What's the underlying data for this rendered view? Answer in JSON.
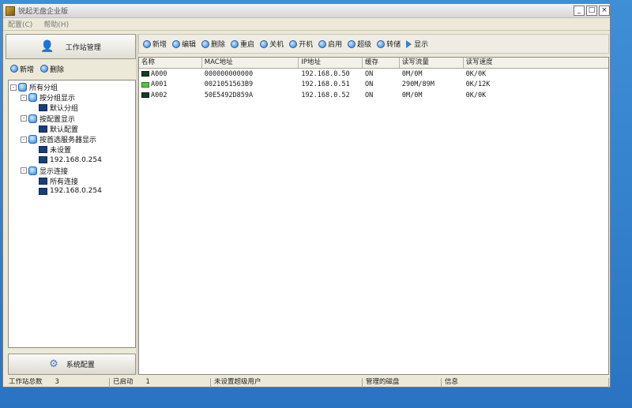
{
  "window": {
    "title": "锐起无盘企业版",
    "controls": {
      "minimize": "_",
      "maximize": "□",
      "close": "×"
    }
  },
  "menu": [
    {
      "label": "配置(C)"
    },
    {
      "label": "帮助(H)"
    }
  ],
  "left_panel": {
    "workstation_button": "工作站管理",
    "add_label": "新增",
    "delete_label": "删除",
    "tree": [
      {
        "label": "所有分组",
        "level": 0,
        "expander": "-",
        "icon": "blue"
      },
      {
        "label": "按分组显示",
        "level": 1,
        "expander": "-",
        "icon": "blue"
      },
      {
        "label": "默认分组",
        "level": 2,
        "expander": "",
        "icon": "host"
      },
      {
        "label": "按配置显示",
        "level": 1,
        "expander": "-",
        "icon": "blue"
      },
      {
        "label": "默认配置",
        "level": 2,
        "expander": "",
        "icon": "host"
      },
      {
        "label": "按首选服务器显示",
        "level": 1,
        "expander": "-",
        "icon": "blue"
      },
      {
        "label": "未设置",
        "level": 2,
        "expander": "",
        "icon": "host"
      },
      {
        "label": "192.168.0.254",
        "level": 2,
        "expander": "",
        "icon": "host"
      },
      {
        "label": "显示连接",
        "level": 1,
        "expander": "-",
        "icon": "blue"
      },
      {
        "label": "所有连接",
        "level": 2,
        "expander": "",
        "icon": "host"
      },
      {
        "label": "192.168.0.254",
        "level": 2,
        "expander": "",
        "icon": "host"
      }
    ],
    "system_button": "系统配置"
  },
  "toolbar": [
    {
      "label": "新增",
      "icon": "add-icon"
    },
    {
      "label": "编辑",
      "icon": "edit-icon"
    },
    {
      "label": "删除",
      "icon": "delete-icon"
    },
    {
      "label": "重启",
      "icon": "restart-icon"
    },
    {
      "label": "关机",
      "icon": "shutdown-icon"
    },
    {
      "label": "开机",
      "icon": "power-on-icon"
    },
    {
      "label": "启用",
      "icon": "enable-icon"
    },
    {
      "label": "超级",
      "icon": "super-icon"
    },
    {
      "label": "转储",
      "icon": "dump-icon"
    },
    {
      "label": "显示",
      "icon": "play-icon"
    }
  ],
  "table": {
    "columns": [
      "名称",
      "MAC地址",
      "IP地址",
      "缓存",
      "读写流量",
      "读写速度"
    ],
    "rows": [
      {
        "online": false,
        "cells": [
          "A000",
          "000000000000",
          "192.168.0.50",
          "ON",
          "0M/0M",
          "0K/0K"
        ]
      },
      {
        "online": true,
        "cells": [
          "A001",
          "0021051563B9",
          "192.168.0.51",
          "ON",
          "290M/89M",
          "0K/12K"
        ]
      },
      {
        "online": false,
        "cells": [
          "A002",
          "50E5492D859A",
          "192.168.0.52",
          "ON",
          "0M/0M",
          "0K/0K"
        ]
      }
    ]
  },
  "status_bar": [
    {
      "label": "工作站总数",
      "value": "3"
    },
    {
      "label": "已启动",
      "value": "1"
    },
    {
      "label": "未设置超级用户",
      "value": ""
    },
    {
      "label": "管理的磁盘",
      "value": ""
    },
    {
      "label": "信息",
      "value": ""
    }
  ]
}
